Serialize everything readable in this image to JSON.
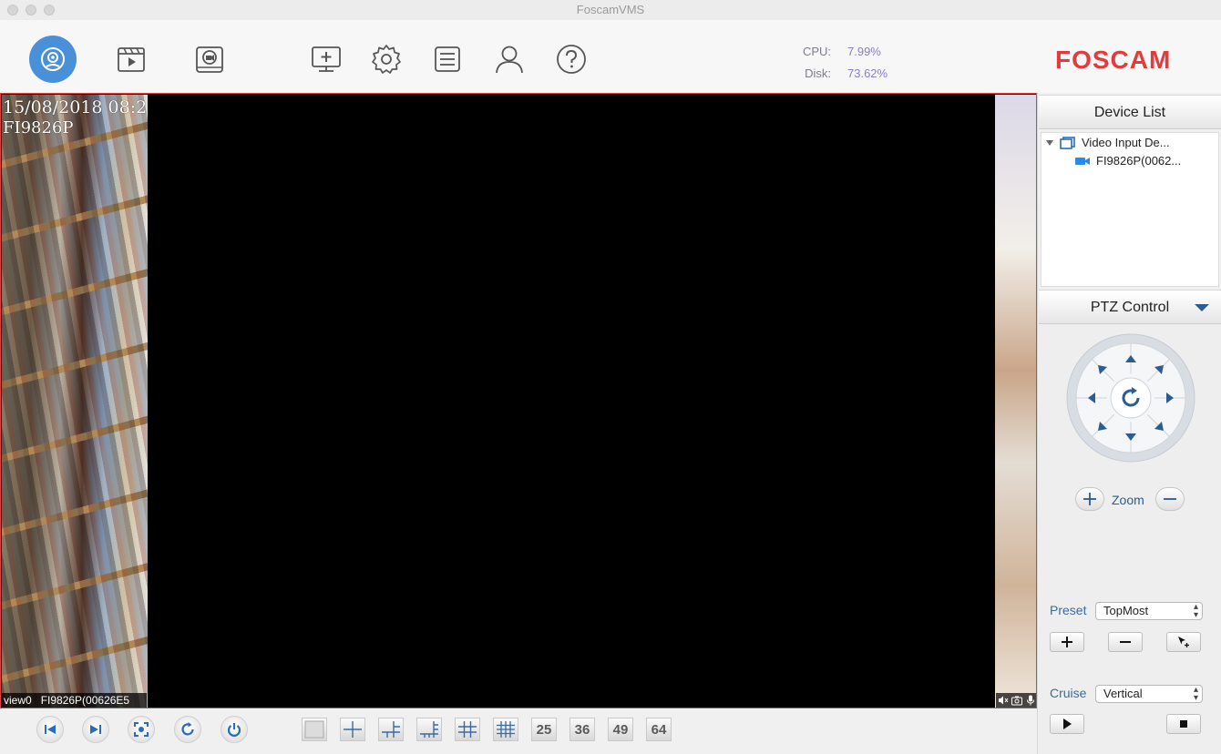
{
  "window": {
    "title": "FoscamVMS"
  },
  "toolbar": {
    "items": [
      {
        "name": "live-view-icon",
        "active": true
      },
      {
        "name": "playback-icon"
      },
      {
        "name": "record-icon"
      },
      {
        "name": "add-device-icon"
      },
      {
        "name": "settings-icon"
      },
      {
        "name": "log-icon"
      },
      {
        "name": "user-icon"
      },
      {
        "name": "help-icon"
      }
    ],
    "cpu_label": "CPU:",
    "cpu_value": "7.99%",
    "disk_label": "Disk:",
    "disk_value": "73.62%",
    "logo": "FOSCAM",
    "accent": "#4a90d9",
    "logo_color": "#e23b3b"
  },
  "video": {
    "osd_datetime": "15/08/2018 08:2",
    "osd_name": "FI9826P",
    "view_name": "view0",
    "view_device": "FI9826P(00626E5",
    "border_color": "#e04040"
  },
  "bottom": {
    "controls": [
      "previous-icon",
      "next-icon",
      "fullscreen-icon",
      "refresh-icon",
      "power-icon"
    ],
    "layouts": [
      "1",
      "4",
      "6",
      "8",
      "9",
      "16",
      "25",
      "36",
      "49",
      "64"
    ]
  },
  "panel": {
    "device_list_title": "Device List",
    "tree_root": "Video Input De...",
    "tree_child": "FI9826P(0062...",
    "ptz_title": "PTZ Control",
    "zoom_label": "Zoom",
    "preset_label": "Preset",
    "preset_value": "TopMost",
    "cruise_label": "Cruise",
    "cruise_value": "Vertical"
  }
}
